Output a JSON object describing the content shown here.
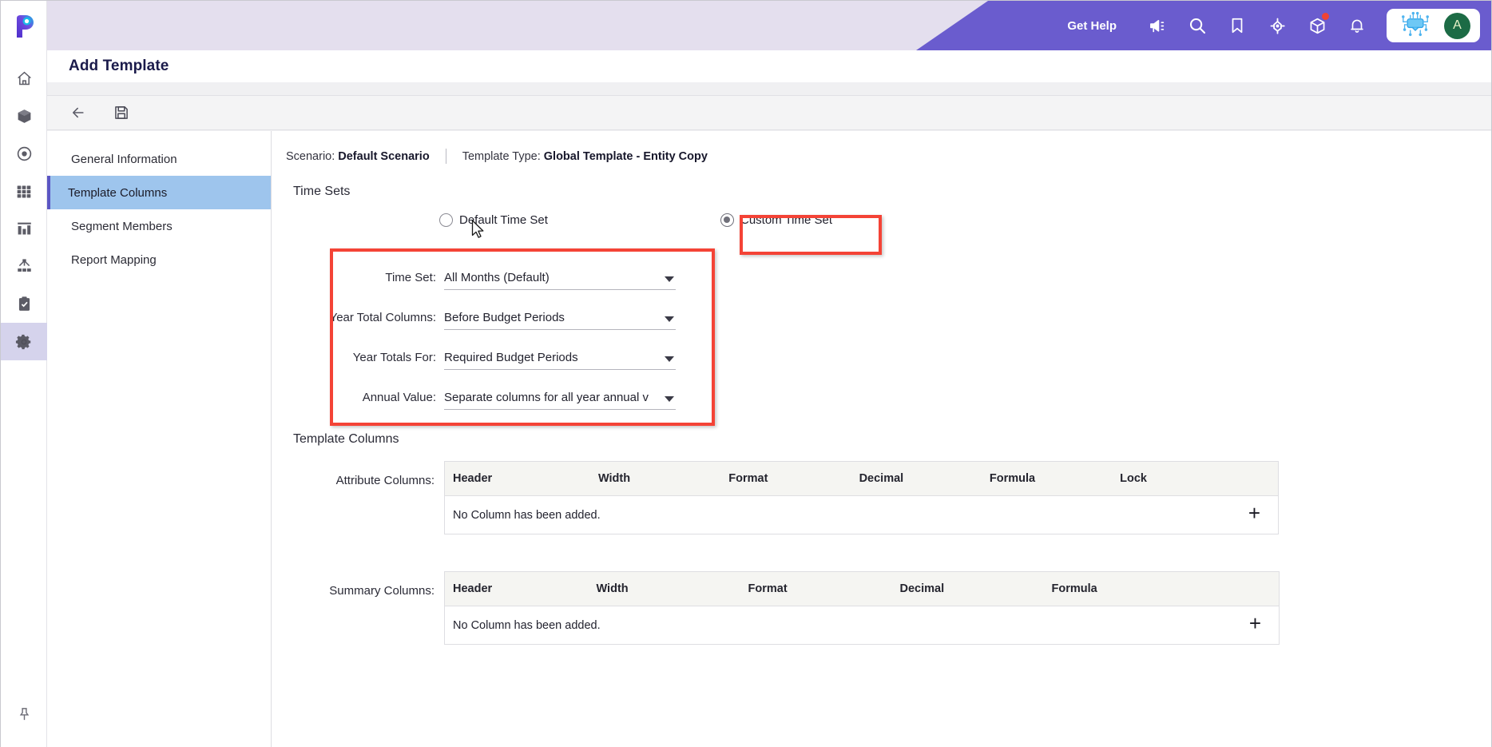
{
  "app": {
    "logo_name": "planful-p-logo",
    "accent_purple": "#6a5cce",
    "highlight_blue": "#9ec5ed",
    "annotation_red": "#f44336"
  },
  "topbar": {
    "get_help_label": "Get Help",
    "icons": [
      {
        "name": "megaphone-announcement-icon"
      },
      {
        "name": "search-icon"
      },
      {
        "name": "bookmark-icon"
      },
      {
        "name": "target-crosshair-icon"
      },
      {
        "name": "cube-package-icon",
        "badge": true
      },
      {
        "name": "bell-notification-icon"
      }
    ],
    "ai_chip_icon": "ai-chip-icon",
    "avatar_initial": "A"
  },
  "rail": {
    "items": [
      {
        "name": "home-icon",
        "label": "Home",
        "active": false
      },
      {
        "name": "cube-icon",
        "label": "Modeling",
        "active": false
      },
      {
        "name": "target-icon",
        "label": "Scenarios",
        "active": false
      },
      {
        "name": "grid-icon",
        "label": "Grid",
        "active": false
      },
      {
        "name": "bar-chart-icon",
        "label": "Reports",
        "active": false
      },
      {
        "name": "hierarchy-icon",
        "label": "Structures",
        "active": false
      },
      {
        "name": "clipboard-check-icon",
        "label": "Tasks",
        "active": false
      },
      {
        "name": "gear-icon",
        "label": "Settings",
        "active": true
      }
    ],
    "pin_icon": "pin-icon"
  },
  "page": {
    "title": "Add Template"
  },
  "toolbar": {
    "back_icon": "back-arrow-icon",
    "save_icon": "save-floppy-icon"
  },
  "leftnav": {
    "items": [
      {
        "label": "General Information",
        "active": false
      },
      {
        "label": "Template Columns",
        "active": true
      },
      {
        "label": "Segment Members",
        "active": false
      },
      {
        "label": "Report Mapping",
        "active": false
      }
    ]
  },
  "meta": {
    "scenario_label": "Scenario:",
    "scenario_value": "Default Scenario",
    "template_type_label": "Template Type:",
    "template_type_value": "Global Template - Entity Copy"
  },
  "time_sets": {
    "heading": "Time Sets",
    "default_option": "Default Time Set",
    "custom_option": "Custom Time Set",
    "selected": "Custom Time Set",
    "fields": [
      {
        "label": "Time Set:",
        "value": "All Months (Default)"
      },
      {
        "label": "Year Total Columns:",
        "value": "Before Budget Periods"
      },
      {
        "label": "Year Totals For:",
        "value": "Required Budget Periods"
      },
      {
        "label": "Annual Value:",
        "value": "Separate columns for all year annual v"
      }
    ]
  },
  "template_columns": {
    "heading": "Template Columns",
    "attribute": {
      "label": "Attribute Columns:",
      "headers": [
        "Header",
        "Width",
        "Format",
        "Decimal",
        "Formula",
        "Lock"
      ],
      "empty_text": "No Column has been added.",
      "add_icon": "plus-add-row-icon"
    },
    "summary": {
      "label": "Summary Columns:",
      "headers": [
        "Header",
        "Width",
        "Format",
        "Decimal",
        "Formula"
      ],
      "empty_text": "No Column has been added.",
      "add_icon": "plus-add-row-icon"
    }
  }
}
